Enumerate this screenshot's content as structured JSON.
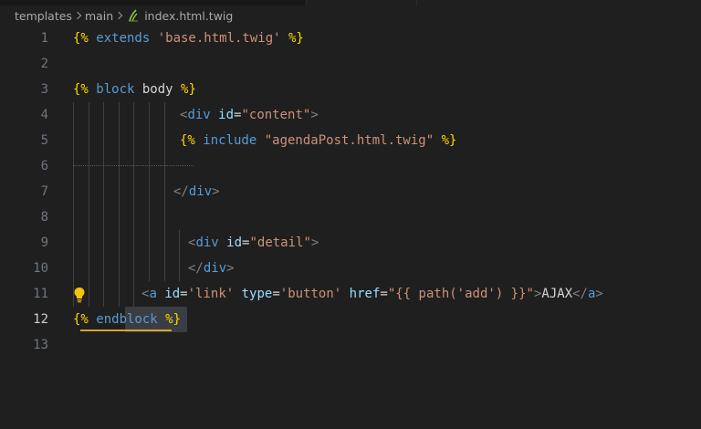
{
  "breadcrumb": {
    "items": [
      "templates",
      "main",
      "index.html.twig"
    ]
  },
  "colors": {
    "background": "#1f1f1f",
    "line_number": "#6e7681",
    "line_number_active": "#cccccc",
    "twig_delimiter": "#ffd700",
    "keyword": "#569cd6",
    "string": "#ce9178",
    "attribute": "#9cdcfe",
    "warning_squiggle": "#d7a52d",
    "file_icon": "#8bc34a"
  },
  "editor": {
    "active_line": 12,
    "lines": [
      {
        "n": "1",
        "tokens": [
          [
            "{%",
            "delim"
          ],
          [
            " extends ",
            "kw"
          ],
          [
            "'base.html.twig'",
            "str"
          ],
          [
            " %}",
            "delim"
          ]
        ]
      },
      {
        "n": "2",
        "tokens": []
      },
      {
        "n": "3",
        "tokens": [
          [
            "{%",
            "delim"
          ],
          [
            " block ",
            "kw"
          ],
          [
            "body",
            "plain"
          ],
          [
            " %}",
            "delim"
          ]
        ]
      },
      {
        "n": "4",
        "tokens": [
          [
            "<",
            "bracket"
          ],
          [
            "div",
            "tag"
          ],
          [
            " ",
            "text"
          ],
          [
            "id",
            "attr"
          ],
          [
            "=",
            "eq"
          ],
          [
            "\"content\"",
            "str"
          ],
          [
            ">",
            "bracket"
          ]
        ]
      },
      {
        "n": "5",
        "tokens": [
          [
            "{%",
            "delim"
          ],
          [
            " include ",
            "kw"
          ],
          [
            "\"agendaPost.html.twig\"",
            "str"
          ],
          [
            " %}",
            "delim"
          ]
        ]
      },
      {
        "n": "6",
        "tokens": []
      },
      {
        "n": "7",
        "tokens": [
          [
            "</",
            "bracket"
          ],
          [
            "div",
            "tag"
          ],
          [
            ">",
            "bracket"
          ]
        ]
      },
      {
        "n": "8",
        "tokens": []
      },
      {
        "n": "9",
        "tokens": [
          [
            "<",
            "bracket"
          ],
          [
            "div",
            "tag"
          ],
          [
            " ",
            "text"
          ],
          [
            "id",
            "attr"
          ],
          [
            "=",
            "eq"
          ],
          [
            "\"detail\"",
            "str"
          ],
          [
            ">",
            "bracket"
          ]
        ]
      },
      {
        "n": "10",
        "tokens": [
          [
            "</",
            "bracket"
          ],
          [
            "div",
            "tag"
          ],
          [
            ">",
            "bracket"
          ]
        ]
      },
      {
        "n": "11",
        "tokens": [
          [
            "<",
            "bracket"
          ],
          [
            "a",
            "tag"
          ],
          [
            " ",
            "text"
          ],
          [
            "id",
            "attr"
          ],
          [
            "=",
            "eq"
          ],
          [
            "'link'",
            "str"
          ],
          [
            " ",
            "text"
          ],
          [
            "type",
            "attr"
          ],
          [
            "=",
            "eq"
          ],
          [
            "'button'",
            "str"
          ],
          [
            " ",
            "text"
          ],
          [
            "href",
            "attr"
          ],
          [
            "=",
            "eq"
          ],
          [
            "\"{{ path('add') }}\"",
            "str"
          ],
          [
            ">",
            "bracket"
          ],
          [
            "AJAX",
            "text"
          ],
          [
            "</",
            "bracket"
          ],
          [
            "a",
            "tag"
          ],
          [
            ">",
            "bracket"
          ]
        ]
      },
      {
        "n": "12",
        "tokens": [
          [
            "{%",
            "delim"
          ],
          [
            " endblock ",
            "kw"
          ],
          [
            "%}",
            "delim"
          ]
        ]
      },
      {
        "n": "13",
        "tokens": []
      }
    ]
  }
}
